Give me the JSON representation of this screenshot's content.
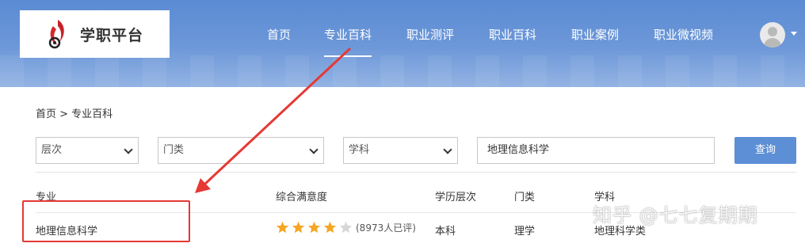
{
  "brand": {
    "name": "学职平台"
  },
  "nav": {
    "items": [
      {
        "label": "首页"
      },
      {
        "label": "专业百科",
        "active": true
      },
      {
        "label": "职业测评"
      },
      {
        "label": "职业百科"
      },
      {
        "label": "职业案例"
      },
      {
        "label": "职业微视频"
      }
    ]
  },
  "breadcrumb": "首页 > 专业百科",
  "filters": {
    "level_select": "层次",
    "category_select": "门类",
    "subject_select": "学科",
    "search_value": "地理信息科学",
    "search_button": "查询"
  },
  "table": {
    "headers": [
      "专业",
      "综合满意度",
      "学历层次",
      "门类",
      "学科"
    ],
    "rows": [
      {
        "major": "地理信息科学",
        "rating_stars": 4,
        "rating_max": 5,
        "rating_count": "(8973人已评)",
        "level": "本科",
        "category": "理学",
        "subject": "地理科学类"
      }
    ]
  },
  "watermark": "知乎 @七七复期期",
  "colors": {
    "header_blue": "#5b8bd3",
    "button_blue": "#5c8fd6",
    "annotation_red": "#e53935",
    "star_gold": "#f5a623"
  }
}
